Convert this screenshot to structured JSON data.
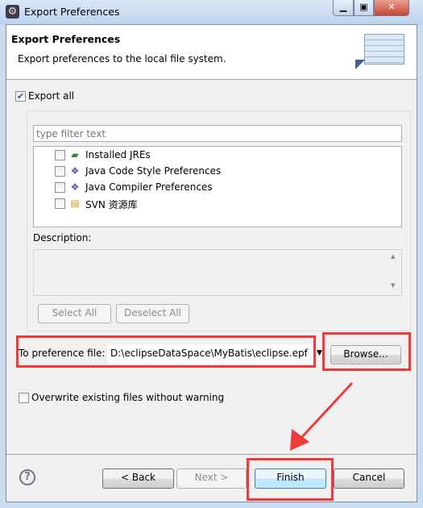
{
  "window": {
    "title": "Export Preferences",
    "controls": [
      "minimize",
      "maximize",
      "close"
    ]
  },
  "header": {
    "title": "Export Preferences",
    "description": "Export preferences to the local file system."
  },
  "export_all": {
    "label": "Export all",
    "checked": true
  },
  "filter": {
    "placeholder": "type filter text",
    "value": ""
  },
  "tree_items": [
    {
      "label": "Installed JREs",
      "icon": "jre-icon",
      "checked": false
    },
    {
      "label": "Java Code Style Preferences",
      "icon": "java-prefs-icon",
      "checked": false
    },
    {
      "label": "Java Compiler Preferences",
      "icon": "java-prefs-icon",
      "checked": false
    },
    {
      "label": "SVN 资源库",
      "icon": "svn-repository-icon",
      "checked": false
    }
  ],
  "description": {
    "label": "Description:",
    "value": ""
  },
  "buttons": {
    "select_all": "Select All",
    "deselect_all": "Deselect All",
    "browse": "Browse...",
    "back": "< Back",
    "next": "Next >",
    "finish": "Finish",
    "cancel": "Cancel"
  },
  "to_file": {
    "label": "To preference file:",
    "value": "D:\\eclipseDataSpace\\MyBatis\\eclipse.epf"
  },
  "overwrite": {
    "label": "Overwrite existing files without warning",
    "checked": false
  },
  "annotation_color": "#f03a3a"
}
